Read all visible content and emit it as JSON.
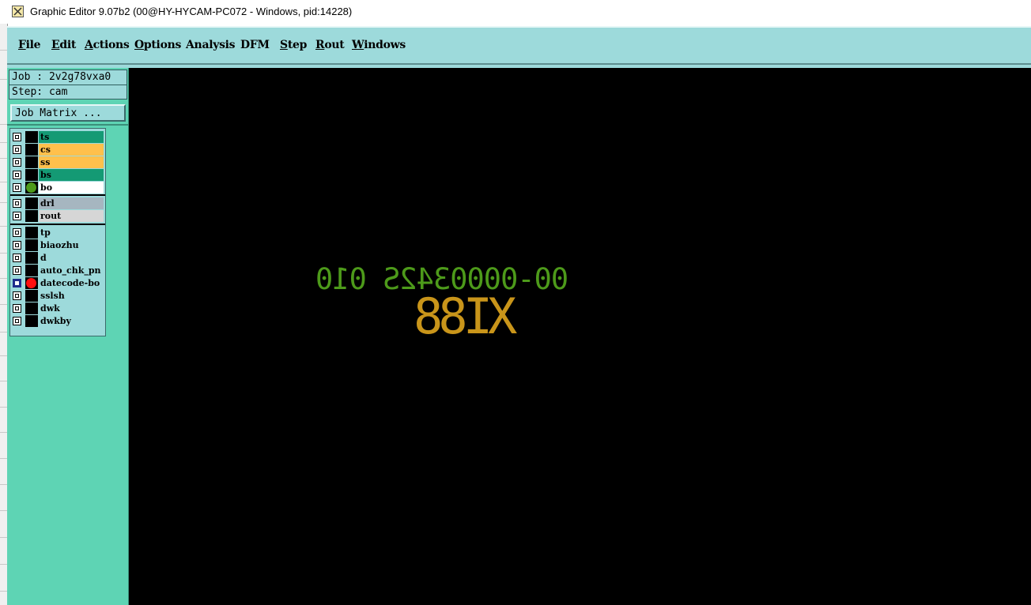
{
  "window": {
    "title": "Graphic Editor 9.07b2 (00@HY-HYCAM-PC072 - Windows, pid:14228)",
    "icon": "app-icon"
  },
  "menu": [
    {
      "label": "File",
      "key": "F"
    },
    {
      "label": "Edit",
      "key": "E"
    },
    {
      "label": "Actions",
      "key": "A"
    },
    {
      "label": "Options",
      "key": "O"
    },
    {
      "label": "Analysis",
      "key": ""
    },
    {
      "label": "DFM",
      "key": ""
    },
    {
      "label": "Step",
      "key": "S"
    },
    {
      "label": "Rout",
      "key": "R"
    },
    {
      "label": "Windows",
      "key": "W"
    }
  ],
  "panel": {
    "job": "Job : 2v2g78vxa0",
    "step": "Step: cam",
    "matrix_button": "Job Matrix ..."
  },
  "layers": [
    {
      "name": "ts",
      "color": "#149a74",
      "dot": null,
      "checked": false
    },
    {
      "name": "cs",
      "color": "#ffc04c",
      "dot": null,
      "checked": false
    },
    {
      "name": "ss",
      "color": "#ffc04c",
      "dot": null,
      "checked": false
    },
    {
      "name": "bs",
      "color": "#149a74",
      "dot": null,
      "checked": false
    },
    {
      "name": "bo",
      "color": "#ffffff",
      "dot": "#4d9a1a",
      "checked": false
    },
    {
      "name": "drl",
      "color": "#a6b6c0",
      "dot": null,
      "checked": false
    },
    {
      "name": "rout",
      "color": "#d6d6d6",
      "dot": null,
      "checked": false
    },
    {
      "name": "tp",
      "color": "#9ddadb",
      "dot": null,
      "checked": false
    },
    {
      "name": "biaozhu",
      "color": "#9ddadb",
      "dot": null,
      "checked": false
    },
    {
      "name": "d",
      "color": "#9ddadb",
      "dot": null,
      "checked": false
    },
    {
      "name": "auto_chk_pn",
      "color": "#9ddadb",
      "dot": null,
      "checked": false
    },
    {
      "name": "datecode-bo",
      "color": "#9ddadb",
      "dot": "#ff1010",
      "checked": true
    },
    {
      "name": "sslsh",
      "color": "#9ddadb",
      "dot": null,
      "checked": false
    },
    {
      "name": "dwk",
      "color": "#9ddadb",
      "dot": null,
      "checked": false
    },
    {
      "name": "dwkby",
      "color": "#9ddadb",
      "dot": null,
      "checked": false
    }
  ],
  "canvas": {
    "line1": "00-0000342S 010",
    "line1_color": "#4d9a1a",
    "line2": "XI88",
    "line2_color": "#c9951a"
  }
}
